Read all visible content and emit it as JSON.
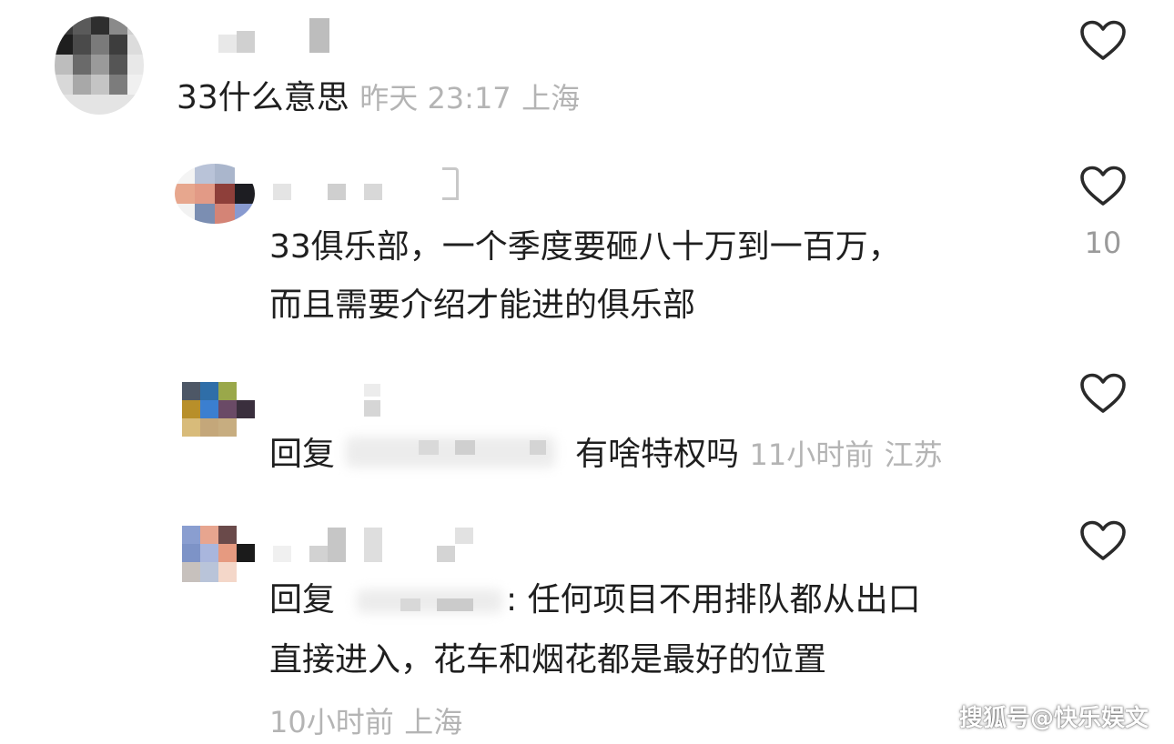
{
  "colors": {
    "text": "#1f1f1f",
    "meta": "#b4b4b4",
    "like_icon": "#2a2a2a",
    "like_count": "#9a9a9a",
    "background": "#ffffff"
  },
  "comments": [
    {
      "text": "33什么意思",
      "time": "昨天 23:17",
      "location": "上海",
      "like_icon": "heart-outline-icon"
    },
    {
      "lines": [
        "33俱乐部，一个季度要砸八十万到一百万，",
        "而且需要介绍才能进的俱乐部"
      ],
      "like_icon": "heart-outline-icon",
      "like_count": "10"
    },
    {
      "reply_prefix": "回复",
      "text": "有啥特权吗",
      "time": "11小时前",
      "location": "江苏",
      "like_icon": "heart-outline-icon"
    },
    {
      "reply_prefix": "回复",
      "text_line1": ": 任何项目不用排队都从出口",
      "text_line2": "直接进入，花车和烟花都是最好的位置",
      "time": "10小时前",
      "location": "上海",
      "like_icon": "heart-outline-icon"
    }
  ],
  "watermark": "搜狐号@快乐娱文"
}
